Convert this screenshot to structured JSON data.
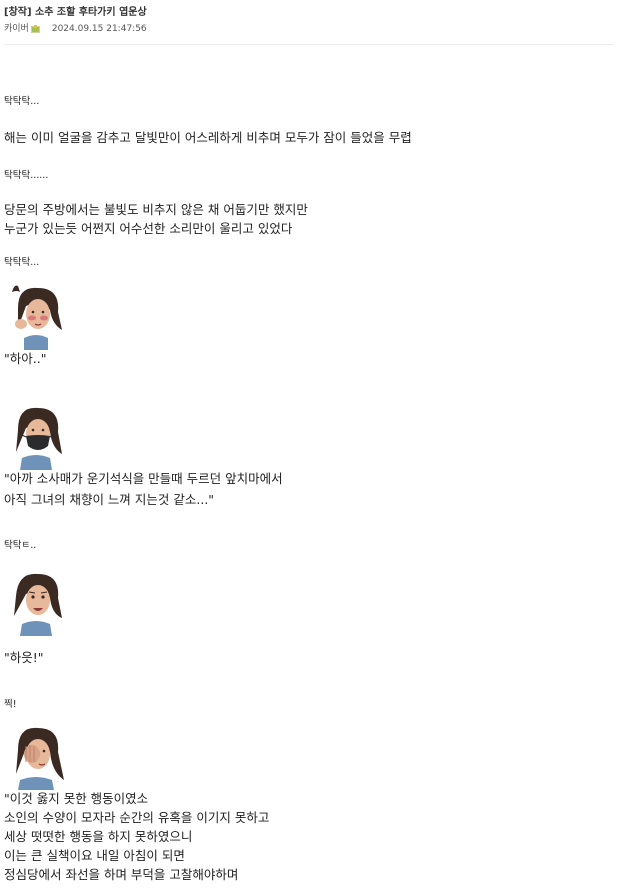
{
  "post": {
    "title": "[창작] 소추 조할 후타가키 엽운상",
    "author": "카이버",
    "date": "2024.09.15 21:47:56"
  },
  "story": {
    "l1": "탁탁탁...",
    "l2": "해는 이미 얼굴을 감추고 달빛만이 어스레하게 비추며 모두가 잠이 들었을 무렵",
    "l3": "탁탁탁......",
    "l4": "당문의 주방에서는 불빛도 비추지 않은 채 어둡기만 했지만",
    "l5": "누군가 있는듯 어쩐지 어수선한 소리만이 울리고 있었다",
    "l6": "탁탁탁...",
    "l7": "\"하아..\"",
    "l8": "\"아까 소사매가 운기석식을 만들때 두르던 앞치마에서",
    "l9": "아직 그녀의 채향이 느껴 지는것 같소...\"",
    "l10": "탁탁ㅌ..",
    "l11": "\"하읏!\"",
    "l12": "찍!",
    "l13": "\"이것 옳지 못한 행동이였소",
    "l14": "소인의 수양이 모자라 순간의 유혹을 이기지 못하고",
    "l15": "세상 떳떳한 행동을 하지 못하였으니",
    "l16": "이는 큰 실책이요 내일 아침이 되면",
    "l17": "정심당에서 좌선을 하며 부덕을 고찰해야하며"
  },
  "colors": {
    "text": "#222222",
    "skin": "#e8b89a",
    "hair": "#3a2a22",
    "robe": "#6f93b8",
    "mask": "#2b2b2b"
  },
  "icons": {
    "author_badge": "badge-icon",
    "portraits": [
      "blushing-portrait-icon",
      "masked-portrait-icon",
      "startled-portrait-icon",
      "covering-face-portrait-icon"
    ]
  }
}
